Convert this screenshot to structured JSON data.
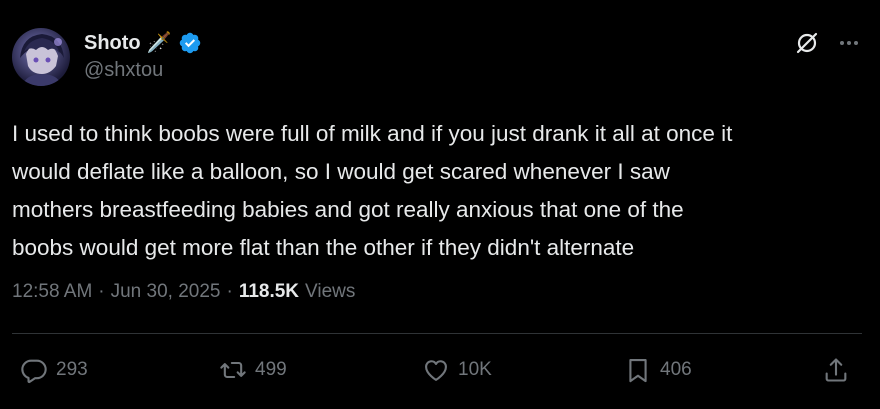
{
  "author": {
    "display_name": "Shoto",
    "emoji": "🗡️",
    "handle": "@shxtou",
    "verified": true,
    "verified_color": "#1d9bf0"
  },
  "header_icons": [
    "grok-icon",
    "more-dots-icon"
  ],
  "tweet": {
    "text": "I used to think boobs were full of milk and if you just drank it all at once it\nwould deflate like a balloon, so I would get scared whenever I saw\nmothers breastfeeding babies and got really anxious that one of the\nboobs would get more flat than the other if they didn't alternate"
  },
  "meta": {
    "time": "12:58 AM",
    "separator": "·",
    "date": "Jun 30, 2025",
    "views_count": "118.5K",
    "views_label": "Views"
  },
  "actions": {
    "replies": "293",
    "reposts": "499",
    "likes": "10K",
    "bookmarks": "406"
  },
  "colors": {
    "background": "#000000",
    "text": "#e7e9ea",
    "secondary": "#71767b",
    "divider": "#2f3336"
  }
}
